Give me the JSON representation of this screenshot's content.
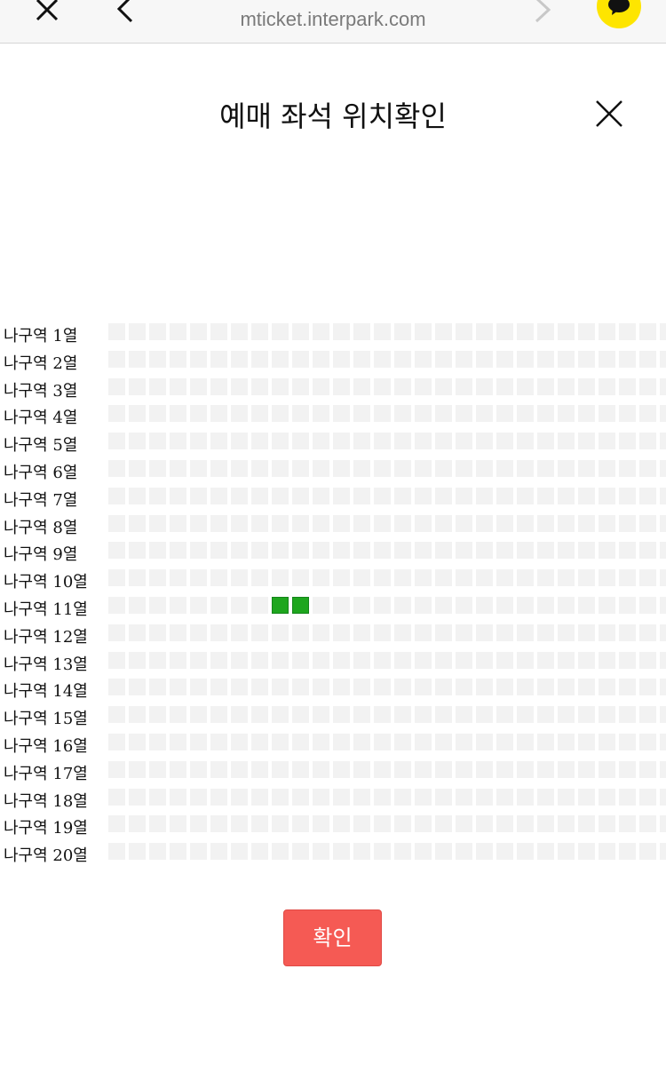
{
  "browser": {
    "close_icon": "close-icon",
    "back_icon": "chevron-left-icon",
    "forward_icon": "chevron-right-icon",
    "url": "mticket.interpark.com",
    "talk_icon": "kakaotalk-chat-icon",
    "talk_color": "#fee500"
  },
  "modal": {
    "title": "예매 좌석 위치확인",
    "close_icon": "close-icon"
  },
  "seat_map": {
    "row_labels": [
      "나구역 1열",
      "나구역 2열",
      "나구역 3열",
      "나구역 4열",
      "나구역 5열",
      "나구역 6열",
      "나구역 7열",
      "나구역 8열",
      "나구역 9열",
      "나구역 10열",
      "나구역 11열",
      "나구역 12열",
      "나구역 13열",
      "나구역 14열",
      "나구역 15열",
      "나구역 16열",
      "나구역 17열",
      "나구역 18열",
      "나구역 19열",
      "나구역 20열"
    ],
    "seats_per_row_visible": 28,
    "selected_seats": [
      {
        "row": 11,
        "seat": 9
      },
      {
        "row": 11,
        "seat": 10
      }
    ],
    "empty_seat_color": "#f2f2f2",
    "selected_seat_color": "#1ea61e"
  },
  "confirm": {
    "label": "확인",
    "color": "#f55a54"
  }
}
